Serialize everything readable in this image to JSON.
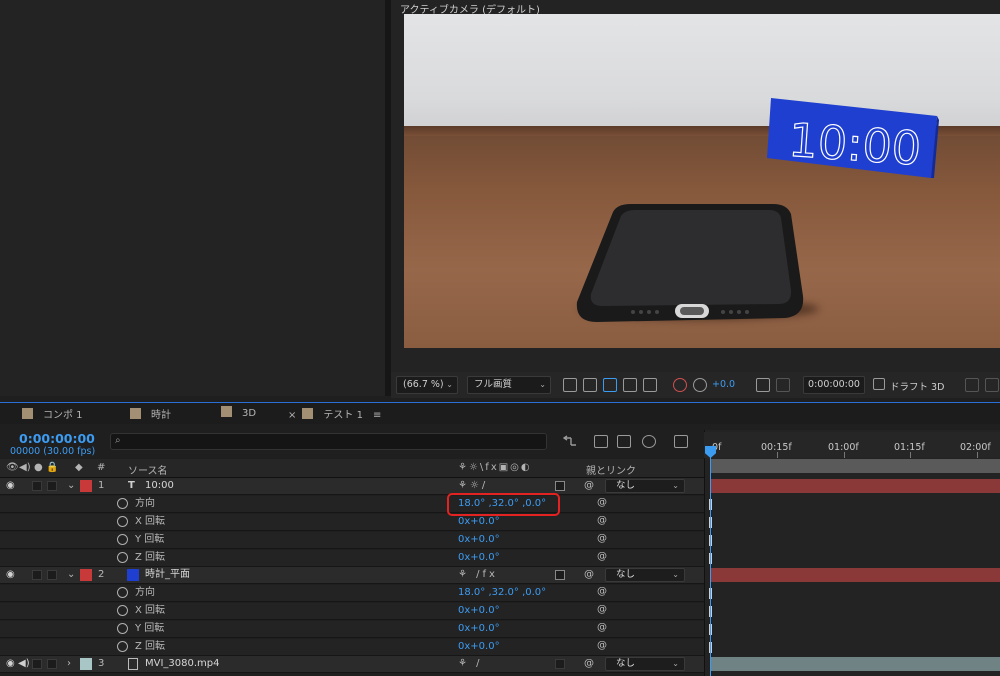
{
  "viewer": {
    "title": "アクティブカメラ (デフォルト)",
    "overlay_text": "10:00",
    "toolbar": {
      "zoom": "(66.7 %)",
      "quality": "フル画質",
      "exposure": "+0.0",
      "timecode": "0:00:00:00",
      "renderer": "ドラフト 3D"
    }
  },
  "tabs": [
    {
      "label": "コンポ 1",
      "swatch": "#a38f73"
    },
    {
      "label": "時計",
      "swatch": "#a38f73"
    },
    {
      "label": "3D",
      "swatch": "#a38f73"
    },
    {
      "label": "テスト 1",
      "swatch": "#a38f73",
      "active": true
    }
  ],
  "timeline": {
    "current_time": "0:00:00:00",
    "fps_info": "00000 (30.00 fps)",
    "columns": {
      "number": "#",
      "source_name": "ソース名",
      "parent": "親とリンク"
    },
    "ruler": [
      "0f",
      "00:15f",
      "01:00f",
      "01:15f",
      "02:00f"
    ],
    "layers": [
      {
        "number": "1",
        "type_icon": "T",
        "name": "10:00",
        "label_color": "#c83a3a",
        "parent": "なし",
        "props": [
          {
            "name": "方向",
            "value": "18.0° ,32.0° ,0.0°"
          },
          {
            "name": "X 回転",
            "value": "0x+0.0°"
          },
          {
            "name": "Y 回転",
            "value": "0x+0.0°"
          },
          {
            "name": "Z 回転",
            "value": "0x+0.0°"
          }
        ]
      },
      {
        "number": "2",
        "name": "時計_平面",
        "label_color": "#c83a3a",
        "solid_color": "#1f3fd0",
        "parent": "なし",
        "props": [
          {
            "name": "方向",
            "value": "18.0° ,32.0° ,0.0°"
          },
          {
            "name": "X 回転",
            "value": "0x+0.0°"
          },
          {
            "name": "Y 回転",
            "value": "0x+0.0°"
          },
          {
            "name": "Z 回転",
            "value": "0x+0.0°"
          }
        ]
      },
      {
        "number": "3",
        "name": "MVI_3080.mp4",
        "label_color": "#a8c6c6",
        "parent": "なし"
      }
    ]
  },
  "colors": {
    "accent": "#3c9cf2",
    "highlight": "#e32222",
    "layer_bar_red": "#8a3838",
    "layer_bar_teal": "#6f8384"
  }
}
